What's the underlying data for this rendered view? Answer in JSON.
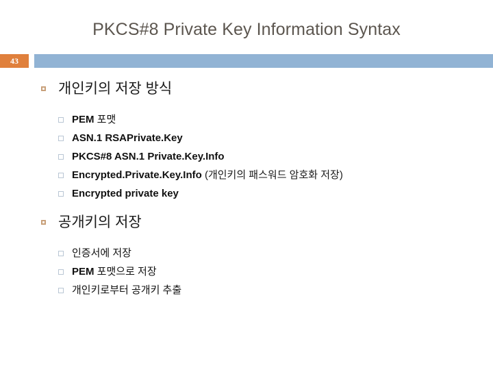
{
  "slide": {
    "title": "PKCS#8 Private Key Information Syntax",
    "page_number": "43",
    "colors": {
      "title_text": "#5c564f",
      "badge_background": "#e0803c",
      "badge_text": "#ffffff",
      "rule_bar": "#91b3d4",
      "bullet_level1_border": "#c8a07a",
      "bullet_level2_border": "#b9c6d4",
      "body_text": "#111111",
      "background": "#ffffff"
    },
    "sections": [
      {
        "heading": "개인키의 저장 방식",
        "items": [
          {
            "bold": "PEM",
            "regular": " 포맷",
            "note": ""
          },
          {
            "bold": "ASN.1  RSAPrivate.Key",
            "regular": "",
            "note": ""
          },
          {
            "bold": "PKCS#8 ASN.1  Private.Key.Info",
            "regular": "",
            "note": ""
          },
          {
            "bold": "Encrypted.Private.Key.Info",
            "regular": "",
            "note": " (개인키의 패스워드 암호화 저장)"
          },
          {
            "bold": "Encrypted  private  key",
            "regular": "",
            "note": ""
          }
        ]
      },
      {
        "heading": "공개키의 저장",
        "items": [
          {
            "bold": "",
            "regular": "인증서에 저장",
            "note": ""
          },
          {
            "bold": "PEM",
            "regular": " 포맷으로 저장",
            "note": ""
          },
          {
            "bold": "",
            "regular": "개인키로부터 공개키 추출",
            "note": ""
          }
        ]
      }
    ]
  }
}
